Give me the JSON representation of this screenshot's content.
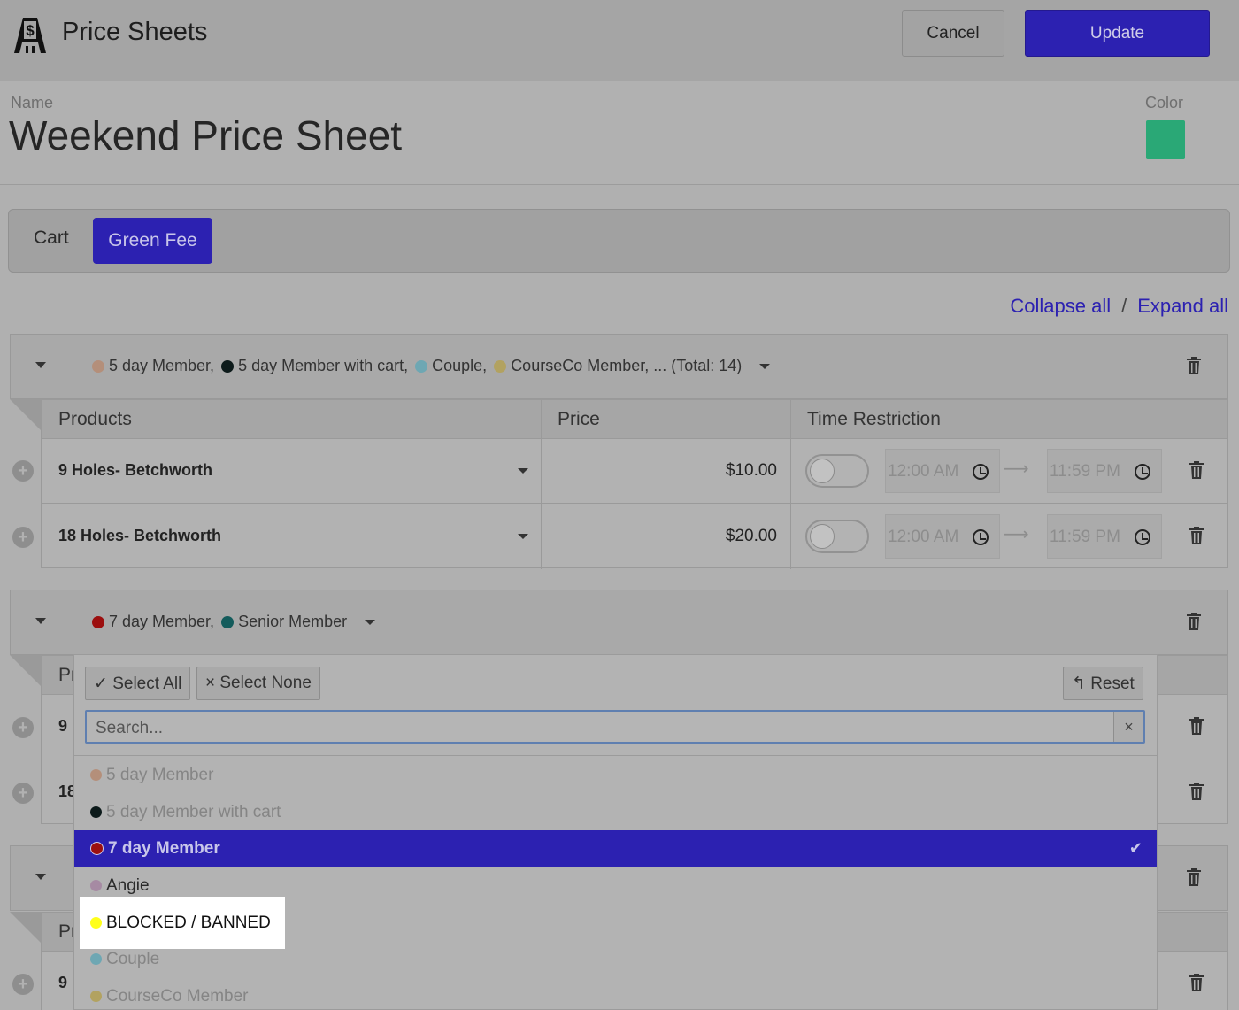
{
  "header": {
    "title": "Price Sheets",
    "cancel_label": "Cancel",
    "update_label": "Update"
  },
  "sheet": {
    "name_label": "Name",
    "name_value": "Weekend Price Sheet",
    "color_label": "Color",
    "color_value": "#2aa876"
  },
  "tabs": [
    {
      "label": "Cart",
      "active": false
    },
    {
      "label": "Green Fee",
      "active": true
    }
  ],
  "links": {
    "collapse_all": "Collapse all",
    "separator": "/",
    "expand_all": "Expand all"
  },
  "groups": [
    {
      "tags": [
        {
          "label": "5 day Member,",
          "color": "#b48f7a"
        },
        {
          "label": "5 day Member with cart,",
          "color": "#0d1b1b"
        },
        {
          "label": "Couple,",
          "color": "#6ea7b3"
        },
        {
          "label": "CourseCo Member, ... (Total: 14)",
          "color": "#b2a260"
        }
      ],
      "columns": {
        "products": "Products",
        "price": "Price",
        "time": "Time Restriction"
      },
      "rows": [
        {
          "product": "9 Holes- Betchworth",
          "price": "$10.00",
          "start": "12:00 AM",
          "end": "11:59 PM"
        },
        {
          "product": "18 Holes- Betchworth",
          "price": "$20.00",
          "start": "12:00 AM",
          "end": "11:59 PM"
        }
      ]
    },
    {
      "tags": [
        {
          "label": "7 day Member,",
          "color": "#9c0f0f"
        },
        {
          "label": "Senior Member",
          "color": "#145c5c"
        }
      ],
      "partial_header": "Pr",
      "partial_rows": [
        "9",
        "18"
      ]
    },
    {
      "partial_header": "Pr",
      "partial_rows": [
        "9"
      ]
    }
  ],
  "dropdown": {
    "select_all": "✓ Select All",
    "select_none": "× Select None",
    "reset": "↰ Reset",
    "search_placeholder": "Search...",
    "clear": "×",
    "options": [
      {
        "label": "5 day Member",
        "color": "#b48f7a",
        "state": "dim"
      },
      {
        "label": "5 day Member with cart",
        "color": "#0d1b1b",
        "state": "dim"
      },
      {
        "label": "7 day Member",
        "color": "#9c0f0f",
        "state": "selected"
      },
      {
        "label": "Angie",
        "color": "#a68aa3",
        "state": "normal"
      },
      {
        "label": "BLOCKED / BANNED",
        "color": "#ffff1a",
        "state": "highlight"
      },
      {
        "label": "Couple",
        "color": "#6ea7b3",
        "state": "dim"
      },
      {
        "label": "CourseCo Member",
        "color": "#b2a260",
        "state": "dim"
      }
    ],
    "check": "✔"
  }
}
